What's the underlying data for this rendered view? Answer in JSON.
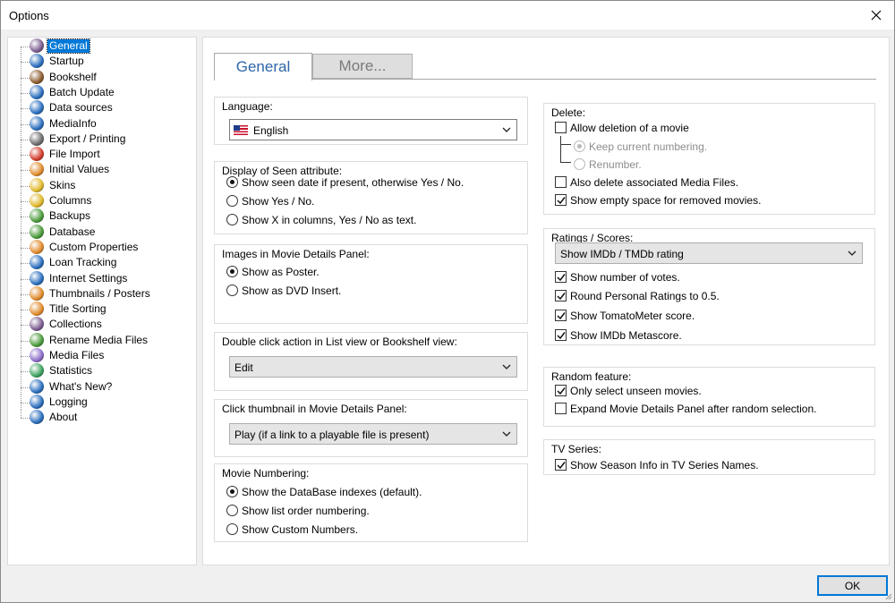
{
  "window": {
    "title": "Options"
  },
  "tree": {
    "items": [
      {
        "label": "General",
        "icon": "general-icon",
        "color": "#7a5b8f",
        "selected": true
      },
      {
        "label": "Startup",
        "icon": "startup-icon",
        "color": "#2a6ebd"
      },
      {
        "label": "Bookshelf",
        "icon": "bookshelf-icon",
        "color": "#8b5a2b"
      },
      {
        "label": "Batch Update",
        "icon": "batch-update-icon",
        "color": "#2a6ebd"
      },
      {
        "label": "Data sources",
        "icon": "data-sources-icon",
        "color": "#2a6ebd"
      },
      {
        "label": "MediaInfo",
        "icon": "mediainfo-icon",
        "color": "#2a6ebd"
      },
      {
        "label": "Export / Printing",
        "icon": "printer-icon",
        "color": "#6b6b6b"
      },
      {
        "label": "File Import",
        "icon": "file-import-icon",
        "color": "#d23a2a"
      },
      {
        "label": "Initial Values",
        "icon": "initial-values-icon",
        "color": "#e08a2a"
      },
      {
        "label": "Skins",
        "icon": "skins-icon",
        "color": "#e0b82a"
      },
      {
        "label": "Columns",
        "icon": "columns-icon",
        "color": "#e0b82a"
      },
      {
        "label": "Backups",
        "icon": "backups-icon",
        "color": "#4a9a3a"
      },
      {
        "label": "Database",
        "icon": "database-icon",
        "color": "#4a9a3a"
      },
      {
        "label": "Custom Properties",
        "icon": "custom-properties-icon",
        "color": "#e08a2a"
      },
      {
        "label": "Loan Tracking",
        "icon": "loan-tracking-icon",
        "color": "#2a6ebd"
      },
      {
        "label": "Internet Settings",
        "icon": "internet-settings-icon",
        "color": "#2a6ebd"
      },
      {
        "label": "Thumbnails / Posters",
        "icon": "thumbnails-icon",
        "color": "#e08a2a"
      },
      {
        "label": "Title Sorting",
        "icon": "title-sorting-icon",
        "color": "#e08a2a"
      },
      {
        "label": "Collections",
        "icon": "collections-icon",
        "color": "#7a5b8f"
      },
      {
        "label": "Rename Media Files",
        "icon": "rename-media-files-icon",
        "color": "#4a9a3a"
      },
      {
        "label": "Media Files",
        "icon": "media-files-icon",
        "color": "#8a6bc8"
      },
      {
        "label": "Statistics",
        "icon": "statistics-icon",
        "color": "#3aa05a"
      },
      {
        "label": "What's New?",
        "icon": "whats-new-icon",
        "color": "#2a6ebd"
      },
      {
        "label": "Logging",
        "icon": "logging-icon",
        "color": "#2a6ebd"
      },
      {
        "label": "About",
        "icon": "about-icon",
        "color": "#2a6ebd"
      }
    ]
  },
  "tabs": {
    "general": "General",
    "more": "More..."
  },
  "language": {
    "title": "Language:",
    "value": "English"
  },
  "seen": {
    "title": "Display of Seen attribute:",
    "opt1": "Show seen date if present, otherwise Yes / No.",
    "opt2": "Show Yes / No.",
    "opt3": "Show X in columns, Yes / No as text."
  },
  "images": {
    "title": "Images in Movie Details Panel:",
    "opt1": "Show as Poster.",
    "opt2": "Show as DVD Insert."
  },
  "dblclick": {
    "title": "Double click action in List view or Bookshelf view:",
    "value": "Edit"
  },
  "thumbclick": {
    "title": "Click thumbnail in Movie Details Panel:",
    "value": "Play (if a link to a playable file is present)"
  },
  "numbering": {
    "title": "Movie Numbering:",
    "opt1": "Show the DataBase indexes (default).",
    "opt2": "Show list order numbering.",
    "opt3": "Show Custom Numbers."
  },
  "delete": {
    "title": "Delete:",
    "allow": "Allow deletion of a movie",
    "keep": "Keep current numbering.",
    "renumber": "Renumber.",
    "also": "Also delete associated Media Files.",
    "empty": "Show empty space for removed movies."
  },
  "ratings": {
    "title": "Ratings / Scores:",
    "value": "Show IMDb / TMDb rating",
    "votes": "Show number of votes.",
    "round": "Round Personal Ratings to 0.5.",
    "tomato": "Show TomatoMeter score.",
    "metascore": "Show IMDb Metascore."
  },
  "random": {
    "title": "Random feature:",
    "unseen": "Only select unseen movies.",
    "expand": "Expand Movie Details Panel after random selection."
  },
  "tv": {
    "title": "TV Series:",
    "season": "Show Season Info in TV Series Names."
  },
  "buttons": {
    "ok": "OK"
  }
}
